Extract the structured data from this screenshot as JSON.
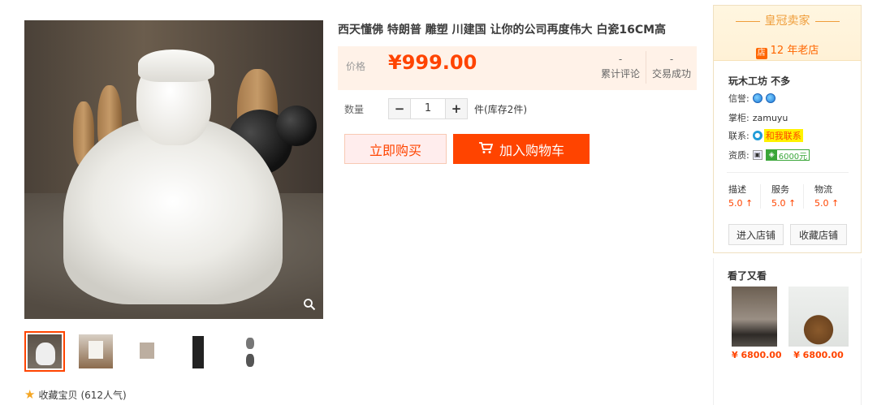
{
  "product": {
    "title": "西天懂佛 特朗普 雕塑 川建国 让你的公司再度伟大 白瓷16CM高",
    "favorite": {
      "label": "收藏宝贝",
      "count": "(612人气)"
    },
    "thumbnails": [
      {
        "icon": "seated-statue-thumb",
        "active": true
      },
      {
        "icon": "statue-box-thumb",
        "active": false
      },
      {
        "icon": "statue-card-thumb",
        "active": false
      },
      {
        "icon": "statue-dark-thumb",
        "active": false
      },
      {
        "icon": "statue-pair-thumb",
        "active": false
      }
    ]
  },
  "price": {
    "label": "价格",
    "value": "¥999.00",
    "stats": [
      {
        "number": "-",
        "label": "累计评论"
      },
      {
        "number": "-",
        "label": "交易成功"
      }
    ]
  },
  "quantity": {
    "label": "数量",
    "minus": "−",
    "value": "1",
    "plus": "+",
    "stock": "件(库存2件)"
  },
  "actions": {
    "buy_now": "立即购买",
    "add_cart": "加入购物车",
    "cart_icon": "cart-icon"
  },
  "shop": {
    "crown": "皇冠卖家",
    "years_icon": "店",
    "years": "12 年老店",
    "name": "玩木工坊 不多",
    "reputation_label": "信誉:",
    "owner_label": "掌柜:",
    "owner": "zamuyu",
    "contact_label": "联系:",
    "contact_text": "和我联系",
    "qualification_label": "资质:",
    "deposit": "6000元",
    "scores": [
      {
        "label": "描述",
        "value": "5.0 ↑"
      },
      {
        "label": "服务",
        "value": "5.0 ↑"
      },
      {
        "label": "物流",
        "value": "5.0 ↑"
      }
    ],
    "enter_button": "进入店铺",
    "collect_button": "收藏店铺"
  },
  "see_also": {
    "title": "看了又看",
    "items": [
      {
        "price": "¥ 6800.00"
      },
      {
        "price": "¥ 6800.00"
      }
    ]
  },
  "colors": {
    "accent": "#ff4400",
    "price_bg": "#fff2e8",
    "crown": "#ef9d3a"
  }
}
